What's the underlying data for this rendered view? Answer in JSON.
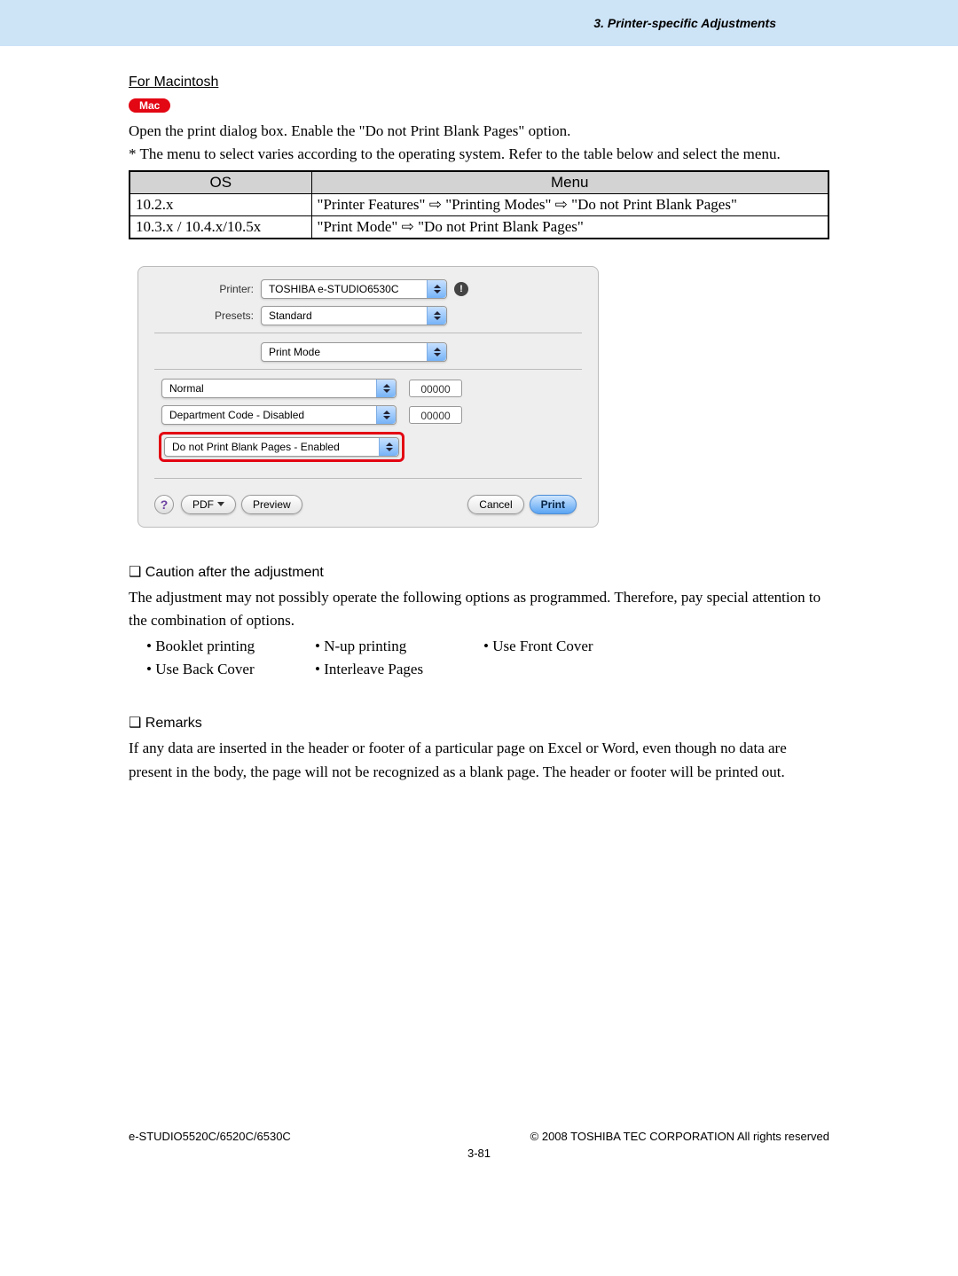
{
  "header": {
    "chapter": "3. Printer-specific Adjustments"
  },
  "section": {
    "title": "For Macintosh",
    "pill": "Mac",
    "intro": "Open the print dialog box.  Enable the \"Do not Print Blank Pages\" option.",
    "note": "* The menu to select varies according to the operating system.  Refer to the table below and select the menu."
  },
  "table": {
    "col_os": "OS",
    "col_menu": "Menu",
    "rows": [
      {
        "os": "10.2.x",
        "menu": "\"Printer Features\" ⇨ \"Printing Modes\" ⇨ \"Do not Print Blank Pages\""
      },
      {
        "os": "10.3.x / 10.4.x/10.5x",
        "menu": "\"Print Mode\" ⇨ \"Do not Print Blank Pages\""
      }
    ]
  },
  "dialog": {
    "labels": {
      "printer": "Printer:",
      "presets": "Presets:"
    },
    "printer_val": "TOSHIBA e-STUDIO6530C",
    "presets_val": "Standard",
    "pane_val": "Print Mode",
    "row1_val": "Normal",
    "row1_num": "00000",
    "row2_val": "Department Code - Disabled",
    "row2_num": "00000",
    "row3_val": "Do not Print Blank Pages - Enabled",
    "btn_pdf": "PDF",
    "btn_preview": "Preview",
    "btn_cancel": "Cancel",
    "btn_print": "Print"
  },
  "caution": {
    "title": "Caution after the adjustment",
    "text": "The adjustment may not possibly operate the following options as programmed.  Therefore, pay special attention to the combination of options.",
    "opts": [
      "Booklet printing",
      "N-up printing",
      "Use Front Cover",
      "Use Back Cover",
      "Interleave Pages"
    ]
  },
  "remarks": {
    "title": "Remarks",
    "text": "If any data are inserted in the header or footer of a particular page on Excel or Word, even though no data are present in the body, the page will not be recognized as a blank page.  The header or footer will be printed out."
  },
  "footer": {
    "left": "e-STUDIO5520C/6520C/6530C",
    "right": "© 2008 TOSHIBA TEC CORPORATION All rights reserved",
    "page": "3-81"
  }
}
